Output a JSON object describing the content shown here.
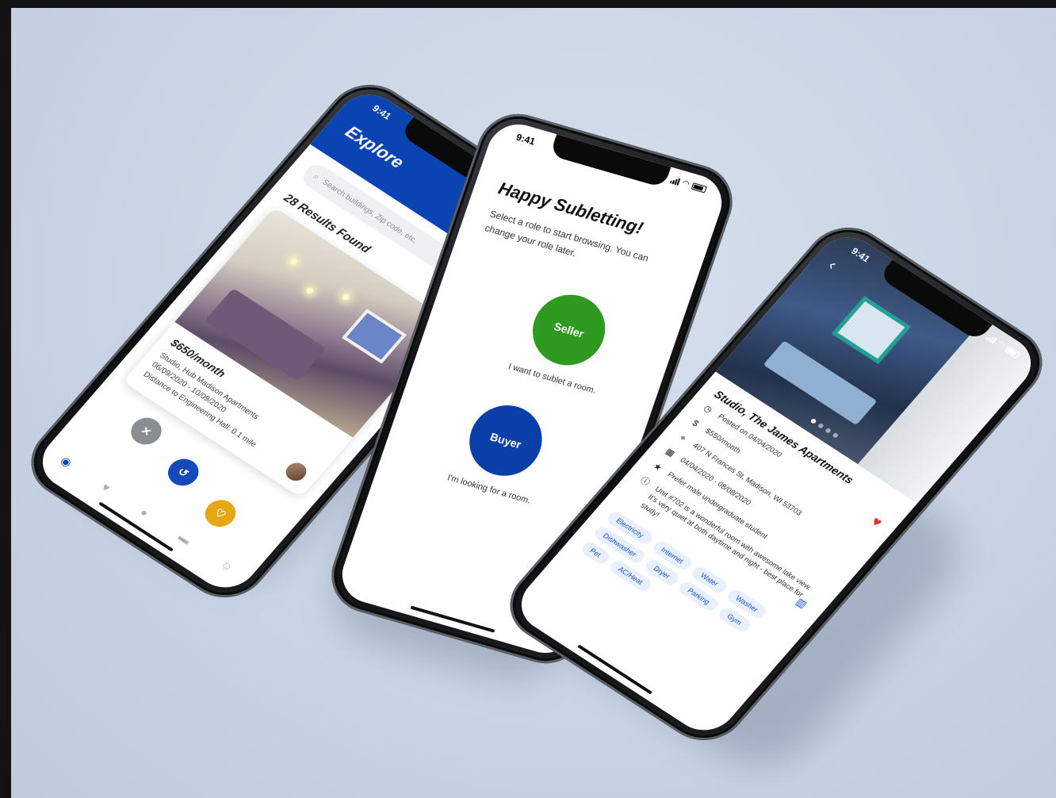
{
  "phone1": {
    "status_time": "9:41",
    "title": "Explore",
    "search_placeholder": "Search buildings, Zip code, etc.",
    "results_label": "28 Results Found",
    "listing": {
      "price": "$650/month",
      "name": "Studio, Hub Madison Apartments",
      "dates": "06/09/2020 - 10/09/2020",
      "distance": "Distance to Engineering Hall: 0.1 mile"
    },
    "actions": {
      "dismiss": "✕",
      "undo": "↺",
      "like": "♡"
    },
    "colors": {
      "brand": "#0a43b2",
      "dismiss": "#8a8d92",
      "undo": "#1548b8",
      "like": "#e5a713"
    },
    "tabs": [
      "explore-icon",
      "heart-icon",
      "chat-icon",
      "card-icon",
      "profile-icon"
    ]
  },
  "phone2": {
    "status_time": "9:41",
    "heading": "Happy Subletting!",
    "subtitle": "Select a role to start browsing. You can change your role later.",
    "seller": {
      "label": "Seller",
      "caption": "I want to sublet a room.",
      "color": "#2e9a1f"
    },
    "buyer": {
      "label": "Buyer",
      "caption": "I'm looking for a room.",
      "color": "#0a3ea8"
    }
  },
  "phone3": {
    "status_time": "9:41",
    "title": "Studio, The James Apartments",
    "posted": "Posted on 04/04/2020",
    "price": "$550/month",
    "address": "407 N Frances St, Madison, WI 53703",
    "dates": "04/04/2020 - 08/08/2020",
    "preference": "Prefer male undergraduate student",
    "description": "Unit #702 is a wonderful room with awesome lake view. It's very quiet at both daytime and night - best place for study!",
    "amenities": [
      "Electricity",
      "Internet",
      "Water",
      "Washer",
      "Dishwasher",
      "Dryer",
      "Parking",
      "Gym",
      "Pet",
      "AC/Heat"
    ],
    "accent": "#1a55d0"
  }
}
